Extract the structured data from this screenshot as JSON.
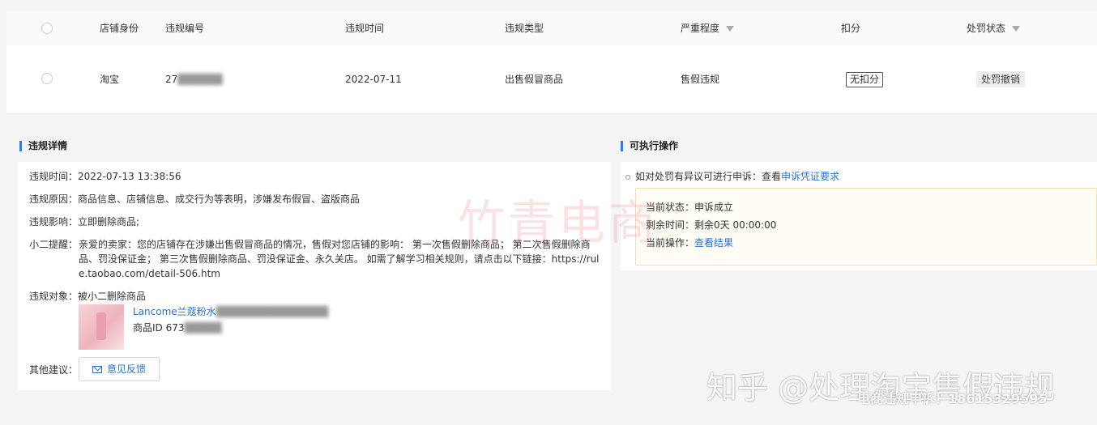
{
  "table": {
    "headers": {
      "shop": "店铺身份",
      "code": "违规编号",
      "time": "违规时间",
      "type": "违规类型",
      "severity": "严重程度",
      "deduct": "扣分",
      "status": "处罚状态"
    },
    "row": {
      "shop": "淘宝",
      "code": "27",
      "time": "2022-07-11",
      "type": "出售假冒商品",
      "severity": "售假违规",
      "deduct": "无扣分",
      "status": "处罚撤销"
    }
  },
  "details": {
    "title": "违规详情",
    "time_label": "违规时间：",
    "time_value": "2022-07-13 13:38:56",
    "reason_label": "违规原因：",
    "reason_value": "商品信息、店铺信息、成交行为等表明，涉嫌发布假冒、盗版商品",
    "impact_label": "违规影响：",
    "impact_value": "立即删除商品;",
    "tip_label": "小二提醒：",
    "tip_value": "亲爱的卖家：您的店铺存在涉嫌出售假冒商品的情况，售假对您店铺的影响： 第一次售假删除商品； 第二次售假删除商品、罚没保证金； 第三次售假删除商品、罚没保证金、永久关店。 如需了解学习相关规则，请点击以下链接：https://rule.taobao.com/detail-506.htm",
    "target_label": "违规对象：",
    "target_value": "被小二删除商品",
    "product_name": "Lancome兰蔻粉水",
    "product_id_label": "商品ID 673",
    "other_label": "其他建议：",
    "feedback_button": "意见反馈"
  },
  "actions": {
    "title": "可执行操作",
    "appeal_text": "如对处罚有异议可进行申诉：查看",
    "appeal_link": "申诉凭证要求",
    "status_label": "当前状态：",
    "status_value": "申诉成立",
    "remaining_label": "剩余时间：",
    "remaining_value": "剩余0天 00:00:00",
    "operation_label": "当前操作：",
    "operation_link": "查看结果"
  },
  "watermarks": {
    "center": "竹青电商",
    "zhihu": "知乎 @处理淘宝售假违规",
    "contact": "电商违规申诉：18615329595"
  }
}
